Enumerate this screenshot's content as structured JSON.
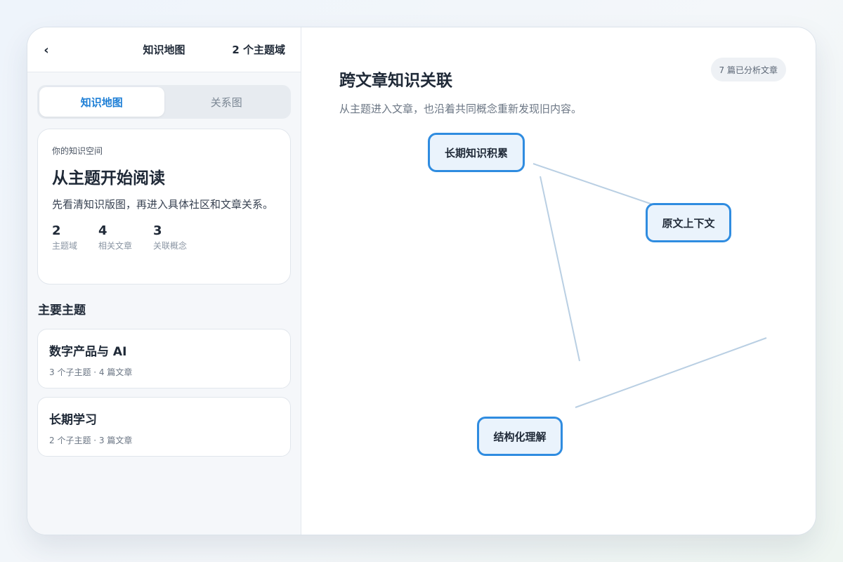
{
  "sidebar": {
    "back_icon": "chevron-left-icon",
    "title": "知识地图",
    "domain_count": "2 个主题域",
    "tabs": [
      {
        "label": "知识地图",
        "active": true
      },
      {
        "label": "关系图",
        "active": false
      }
    ],
    "hero": {
      "kicker": "你的知识空间",
      "title": "从主题开始阅读",
      "description": "先看清知识版图，再进入具体社区和文章关系。",
      "stats": [
        {
          "value": "2",
          "label": "主题域"
        },
        {
          "value": "4",
          "label": "相关文章"
        },
        {
          "value": "3",
          "label": "关联概念"
        }
      ]
    },
    "section_title": "主要主题",
    "topics": [
      {
        "name": "数字产品与 AI",
        "meta": "3 个子主题 · 4 篇文章"
      },
      {
        "name": "长期学习",
        "meta": "2 个子主题 · 3 篇文章"
      }
    ]
  },
  "main": {
    "title": "跨文章知识关联",
    "subtitle": "从主题进入文章，也沿着共同概念重新发现旧内容。",
    "badge": "7 篇已分析文章",
    "graph": {
      "nodes": [
        {
          "label": "长期知识积累"
        },
        {
          "label": "原文上下文"
        },
        {
          "label": "结构化理解"
        }
      ]
    }
  },
  "colors": {
    "accent": "#1e7fd6",
    "node_border": "#2f8ce0",
    "node_fill": "#eaf3fc",
    "edge": "#b9cfe3"
  }
}
